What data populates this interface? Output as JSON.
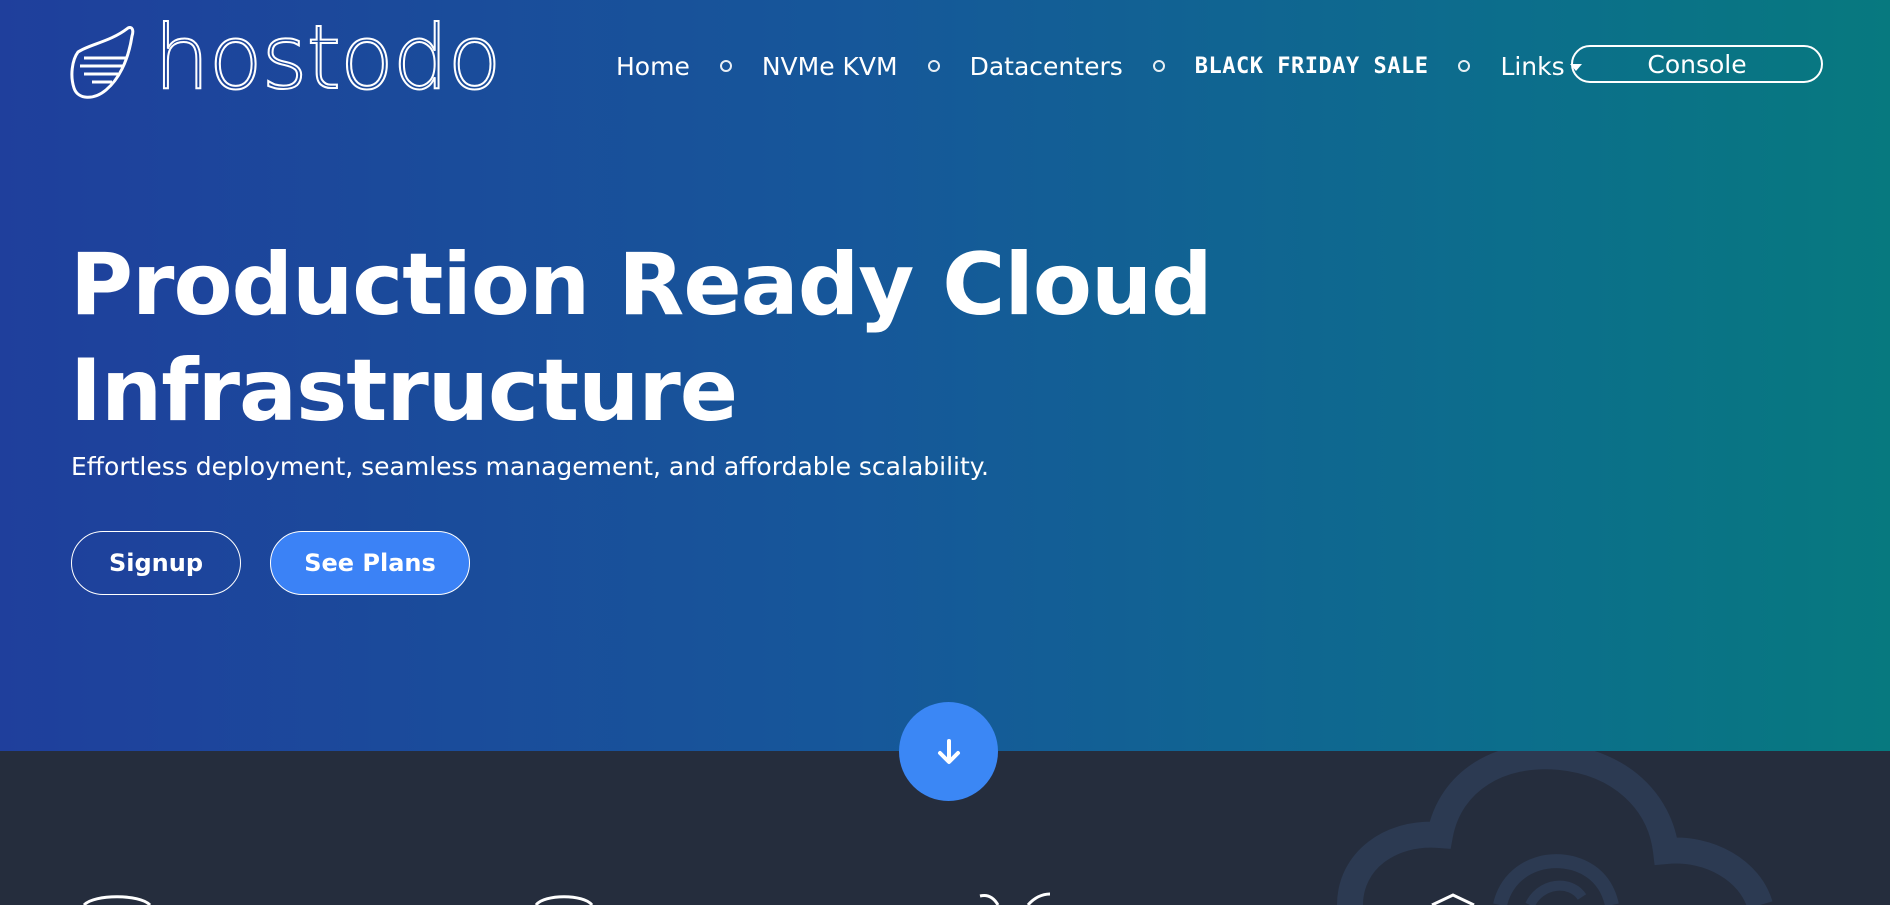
{
  "brand": {
    "name": "hostodo"
  },
  "nav": {
    "items": [
      {
        "label": "Home"
      },
      {
        "label": "NVMe KVM"
      },
      {
        "label": "Datacenters"
      },
      {
        "label": "BLACK FRIDAY SALE"
      },
      {
        "label": "Links"
      }
    ],
    "console_label": "Console"
  },
  "hero": {
    "title_line1": "Production Ready Cloud",
    "title_line2": "Infrastructure",
    "subtitle": "Effortless deployment, seamless management, and affordable scalability.",
    "signup_label": "Signup",
    "plans_label": "See Plans"
  },
  "icons": {
    "logo": "hostodo-logo-mark",
    "scroll": "arrow-down-icon",
    "background": "cloud-icon",
    "dropdown": "caret-down-icon"
  },
  "colors": {
    "gradient_start": "#1f3f9c",
    "gradient_end": "#07797f",
    "accent_blue": "#3b82f6",
    "dark_section": "#252d3d"
  }
}
